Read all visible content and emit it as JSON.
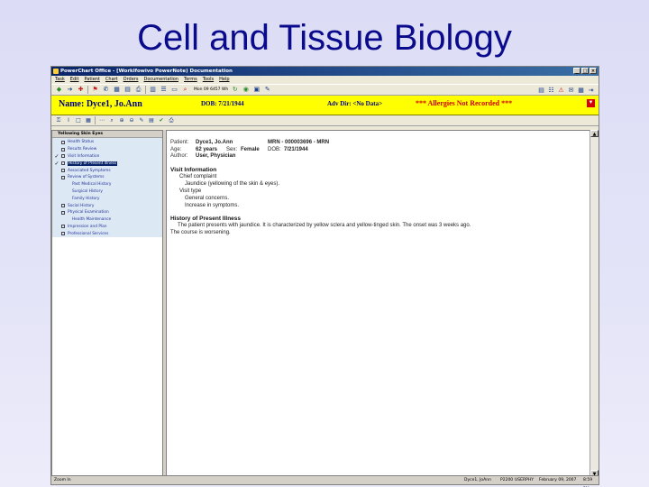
{
  "slide": {
    "title": "Cell and Tissue Biology"
  },
  "window": {
    "title": "PowerChart Office - [Worklfowivo PowerNote) Documentation",
    "controls": [
      "_",
      "□",
      "×"
    ]
  },
  "menu": [
    "Task",
    "Edit",
    "Patient",
    "Chart",
    "Orders",
    "Documentation",
    "Terms",
    "Tools",
    "Help"
  ],
  "toolbar": {
    "search_text": "Mon 09 6457 Wh"
  },
  "banner": {
    "name": "Name: Dyce1, Jo.Ann",
    "dob": "DOB: 7/21/1944",
    "adv_dir": "Adv Dir: <No Data>",
    "allergies": "*** Allergies Not Recorded ***",
    "dropdown": "▼"
  },
  "left_pane": {
    "header": "Yellowing Skin Eyes",
    "items": [
      {
        "label": "Health Status",
        "checked": false,
        "box": true
      },
      {
        "label": "Results Review",
        "checked": false,
        "box": true
      },
      {
        "label": "Visit Information",
        "checked": true,
        "box": true
      },
      {
        "label": "History of Present Illness",
        "checked": true,
        "box": true,
        "selected": true
      },
      {
        "label": "Associated Symptoms",
        "checked": false,
        "box": true
      },
      {
        "label": "Review of Systems",
        "checked": false,
        "box": true
      },
      {
        "label": "Past Medical History",
        "checked": false,
        "box": false
      },
      {
        "label": "Surgical History",
        "checked": false,
        "box": false
      },
      {
        "label": "Family History",
        "checked": false,
        "box": false
      },
      {
        "label": "Social History",
        "checked": false,
        "box": true
      },
      {
        "label": "Physical Examination",
        "checked": false,
        "box": true
      },
      {
        "label": "Health Maintenance",
        "checked": false,
        "box": false
      },
      {
        "label": "Impression and Plan",
        "checked": false,
        "box": true
      },
      {
        "label": "Professional Services",
        "checked": false,
        "box": true
      }
    ]
  },
  "document": {
    "patient_label": "Patient:",
    "patient_value": "Dyce1, Jo.Ann",
    "mrn": "MRN - 000003696 - MRN",
    "age_label": "Age:",
    "age_value": "62 years",
    "sex_label": "Sex:",
    "sex_value": "Female",
    "dob_label": "DOB:",
    "dob_value": "7/21/1944",
    "author_label": "Author:",
    "author_value": "User, Physician",
    "visit_heading": "Visit Information",
    "chief_label": "Chief complaint",
    "chief_value": "Jaundice (yellowing of the skin & eyes).",
    "visit_type_label": "Visit type",
    "visit_type_1": "General concerns.",
    "visit_type_2": "Increase in symptoms.",
    "hpi_heading": "History of Present Illness",
    "hpi_line1": "The patient presents with jaundice. It is characterized by yellow sclera and yellow-tinged skin. The onset was 3 weeks ago.",
    "hpi_line2": "The course is worsening."
  },
  "status": {
    "left": "Zoom In",
    "user": "Dyce1, JoAnn",
    "id": "P2200",
    "node": "USERPHY",
    "date": "February 09, 2007",
    "time": "8:59 PM"
  }
}
